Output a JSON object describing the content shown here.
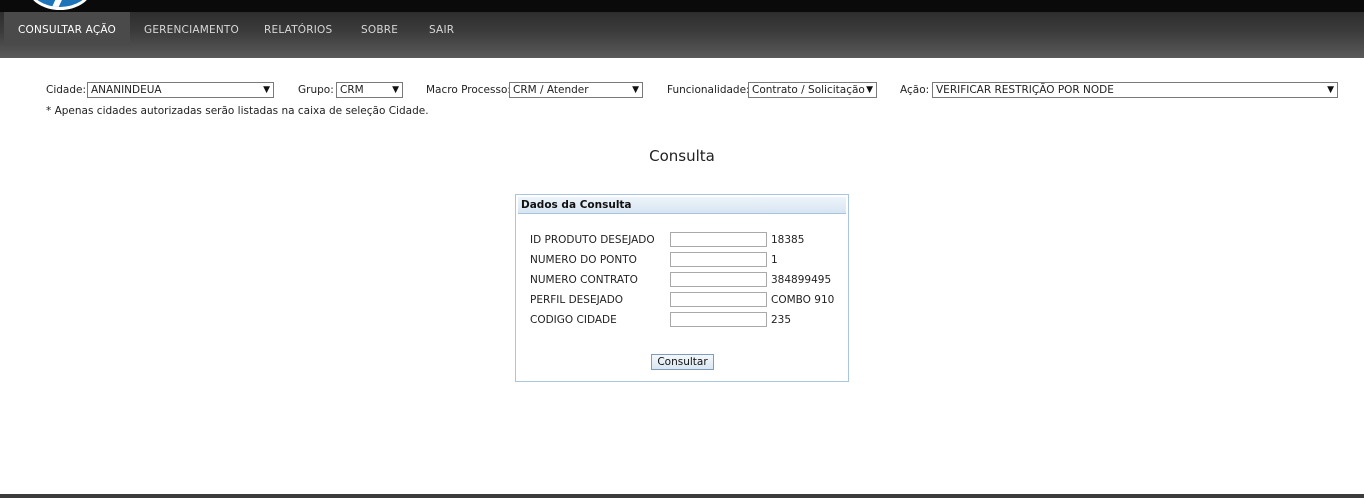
{
  "nav": {
    "items": [
      {
        "label": "CONSULTAR AÇÃO",
        "active": true
      },
      {
        "label": "GERENCIAMENTO",
        "active": false
      },
      {
        "label": "RELATÓRIOS",
        "active": false
      },
      {
        "label": "SOBRE",
        "active": false
      },
      {
        "label": "SAIR",
        "active": false
      }
    ]
  },
  "filters": {
    "cidade": {
      "label": "Cidade:",
      "value": "ANANINDEUA"
    },
    "grupo": {
      "label": "Grupo:",
      "value": "CRM"
    },
    "macro": {
      "label": "Macro Processo:",
      "value": "CRM / Atender"
    },
    "funcionalidade": {
      "label": "Funcionalidade:",
      "value": "Contrato / Solicitação"
    },
    "acao": {
      "label": "Ação:",
      "value": "VERIFICAR RESTRIÇÃO POR NODE"
    },
    "dropdown_icon": "triangle-down-icon"
  },
  "note": "* Apenas cidades autorizadas serão listadas na caixa de seleção Cidade.",
  "page_title": "Consulta",
  "panel": {
    "header": "Dados da Consulta",
    "fields": [
      {
        "label": "ID PRODUTO DESEJADO",
        "input_value": "",
        "value": "18385"
      },
      {
        "label": "NUMERO DO PONTO",
        "input_value": "",
        "value": "1"
      },
      {
        "label": "NUMERO CONTRATO",
        "input_value": "",
        "value": "384899495"
      },
      {
        "label": "PERFIL DESEJADO",
        "input_value": "",
        "value": "COMBO 910"
      },
      {
        "label": "CODIGO CIDADE",
        "input_value": "",
        "value": "235"
      }
    ],
    "submit_label": "Consultar"
  },
  "colors": {
    "nav_bg": "#3a3a3a",
    "nav_active_bg": "#4a4a4a",
    "panel_border": "#aac6de",
    "panel_header": "#d7e5f2",
    "logo_blue": "#1e74b8"
  }
}
